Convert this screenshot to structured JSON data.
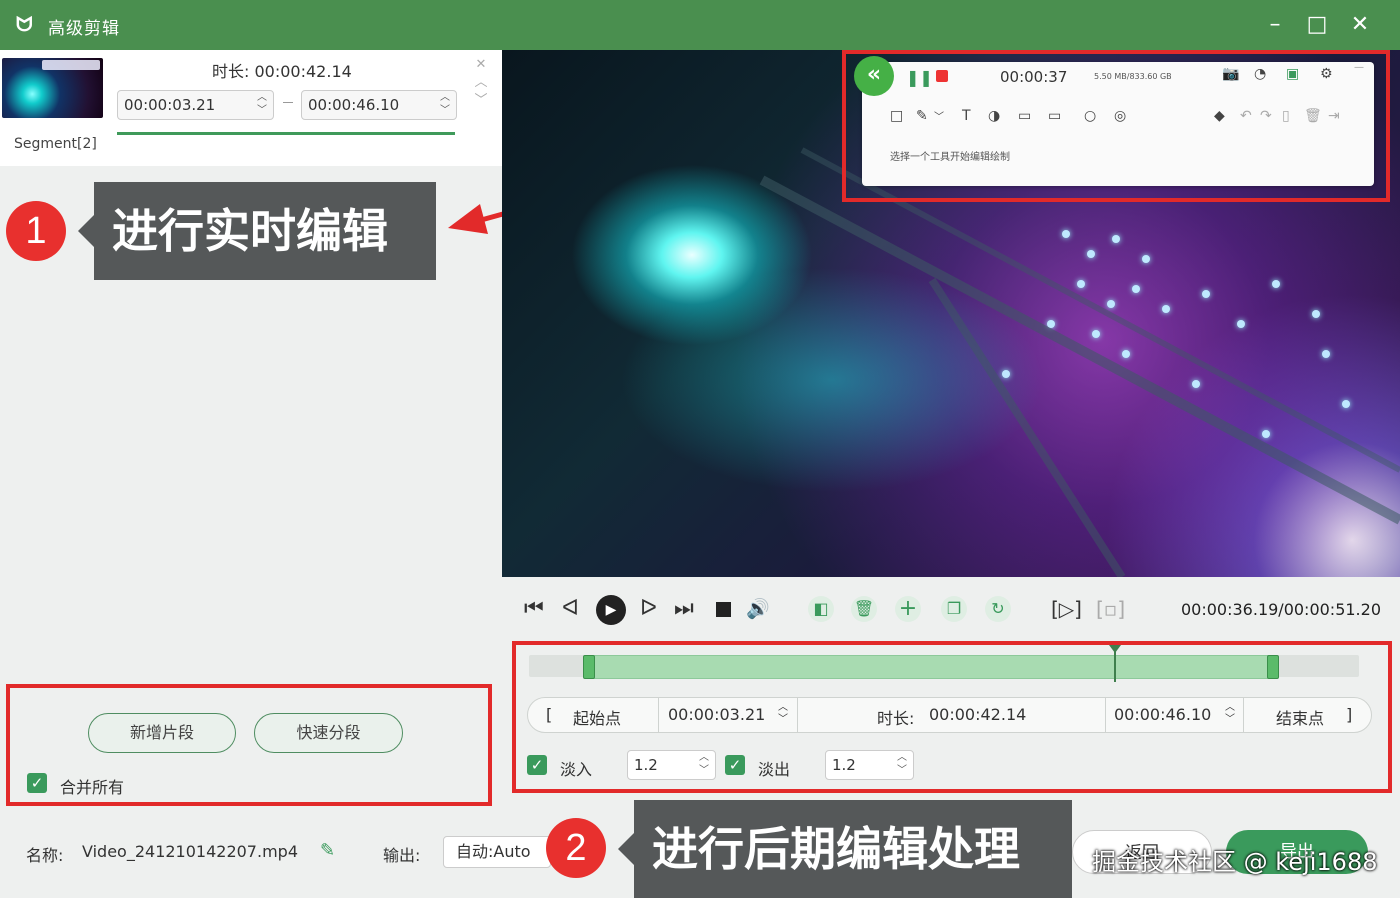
{
  "window": {
    "title": "高级剪辑"
  },
  "segment": {
    "name": "Segment[2]",
    "duration_label": "时长:",
    "duration_value": "00:00:42.14",
    "start": "00:00:03.21",
    "end": "00:00:46.10"
  },
  "annotations": {
    "one": {
      "num": "1",
      "text": "进行实时编辑"
    },
    "two": {
      "num": "2",
      "text": "进行后期编辑处理"
    }
  },
  "left_actions": {
    "add_segment": "新增片段",
    "quick_split": "快速分段",
    "merge_all": "合并所有"
  },
  "recorder": {
    "time": "00:00:37",
    "stats": "5.50 MB/833.60 GB",
    "hint": "选择一个工具开始编辑绘制"
  },
  "player": {
    "timecode": "00:00:36.19/00:00:51.20"
  },
  "trim": {
    "start_label": "起始点",
    "start_value": "00:00:03.21",
    "duration_label": "时长:",
    "duration_value": "00:00:42.14",
    "end_value": "00:00:46.10",
    "end_label": "结束点",
    "fade_in_label": "淡入",
    "fade_in_value": "1.2",
    "fade_out_label": "淡出",
    "fade_out_value": "1.2"
  },
  "bottom": {
    "name_label": "名称:",
    "filename": "Video_241210142207.mp4",
    "output_label": "输出:",
    "output_value": "自动:Auto",
    "back_label": "返回",
    "export_label": "导出"
  },
  "watermark": "掘金技术社区 @ keji1688",
  "colors": {
    "accent": "#4a8f4f",
    "annotation": "#e22a2a"
  }
}
